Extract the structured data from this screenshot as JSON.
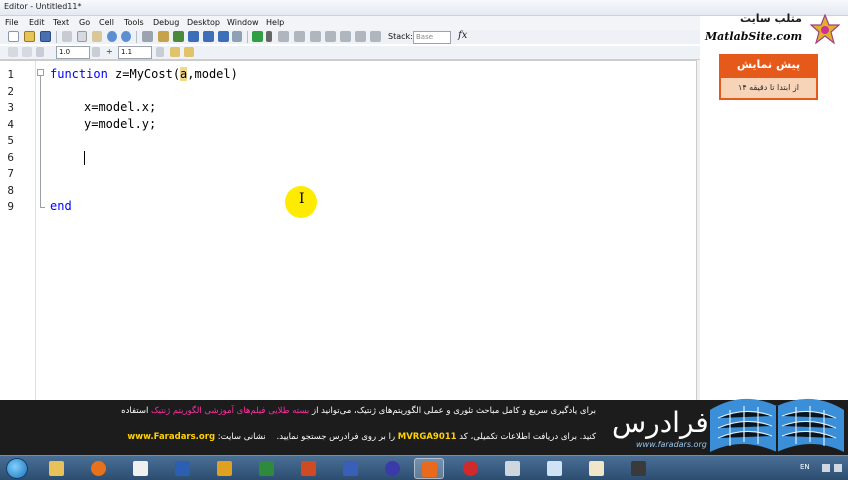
{
  "window": {
    "title": "Editor - Untitled11*"
  },
  "menu": [
    "File",
    "Edit",
    "Text",
    "Go",
    "Cell",
    "Tools",
    "Debug",
    "Desktop",
    "Window",
    "Help"
  ],
  "toolbar": {
    "indent_value": "1.0",
    "divide_symbol": "÷",
    "scale_value": "1.1",
    "stack_label": "Stack:",
    "stack_value": "Base",
    "fx_label": "fx"
  },
  "editor": {
    "line_numbers": [
      "1",
      "2",
      "3",
      "4",
      "5",
      "6",
      "7",
      "8",
      "9"
    ],
    "lines": {
      "l1_keyword": "function",
      "l1_before": " z=MyCost(",
      "l1_highlight": "a",
      "l1_after": ",model)",
      "l3": "x=model.x;",
      "l4": "y=model.y;",
      "l9_keyword": "end"
    },
    "mouse_cursor": "I"
  },
  "watermark": {
    "site_name_fa": "متلب سایت",
    "site_url": "MatlabSite.com"
  },
  "preview_badge": {
    "title": "پیش نمایش",
    "subtitle": "از ابتدا تا دقیقه ۱۴"
  },
  "banner": {
    "line1_part1": "برای یادگیری سریع و کامل مباحث تئوری و عملی الگوریتم‌های ژنتیک، می‌توانید از ",
    "line1_link": "بسته طلایی فیلم‌های آموزشی الگوریتم ژنتیک",
    "line1_part2": " استفاده",
    "line2_part1": "کنید. برای دریافت اطلاعات تکمیلی، کد ",
    "line2_code": "MVRGA9011",
    "line2_part2": " را بر روی فرادرس جستجو نمایید.",
    "site_label": "نشانی سایت:",
    "site_url": "www.Faradars.org",
    "brand_fa": "فرادرس",
    "brand_url": "www.faradars.org"
  },
  "taskbar": {
    "apps": [
      "explorer",
      "firefox",
      "editor",
      "word",
      "outlook",
      "excel",
      "powerpoint",
      "visio",
      "infinity",
      "matlab",
      "virus",
      "calculator",
      "notepad",
      "paint",
      "media"
    ],
    "language": "EN"
  },
  "colors": {
    "keyword": "#0000ff",
    "highlight": "#f0d98a",
    "badge": "#e55a1b",
    "banner_link": "#ff2fa2",
    "banner_code": "#ffd200"
  }
}
